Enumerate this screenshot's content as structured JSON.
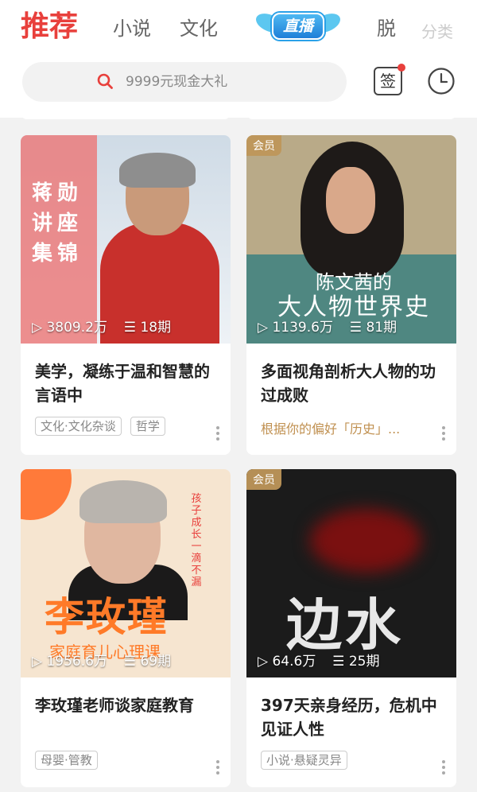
{
  "header": {
    "tabs": [
      "推荐",
      "小说",
      "文化",
      "脱",
      "分类"
    ],
    "live_label": "直播",
    "search_placeholder": "9999元现金大礼",
    "sign_label": "签"
  },
  "cards": [
    {
      "cover_text": "蒋勋讲座集锦",
      "plays": "3809.2万",
      "episodes": "18期",
      "vip": "",
      "title": "美学，凝练于温和智慧的言语中",
      "tags": [
        "文化·文化杂谈",
        "哲学"
      ],
      "recommend": ""
    },
    {
      "cover_text_1": "陈文茜的",
      "cover_text_2": "大人物世界史",
      "plays": "1139.6万",
      "episodes": "81期",
      "vip": "会员",
      "title": "多面视角剖析大人物的功过成败",
      "tags": [],
      "recommend": "根据你的偏好「历史」..."
    },
    {
      "cover_big": "李玫瑾",
      "cover_sub": "家庭育儿心理课",
      "cover_side": "孩子成长一滴不漏",
      "plays": "1956.6万",
      "episodes": "69期",
      "vip": "",
      "title": "李玫瑾老师谈家庭教育",
      "tags": [
        "母婴·管教"
      ],
      "recommend": ""
    },
    {
      "cover_big": "边水",
      "plays": "64.6万",
      "episodes": "25期",
      "vip": "会员",
      "title": "397天亲身经历，危机中见证人性",
      "tags": [
        "小说·悬疑灵异"
      ],
      "recommend": ""
    }
  ],
  "colors": {
    "accent": "#e8403c",
    "vip": "#be965a",
    "recommend": "#c09050"
  }
}
